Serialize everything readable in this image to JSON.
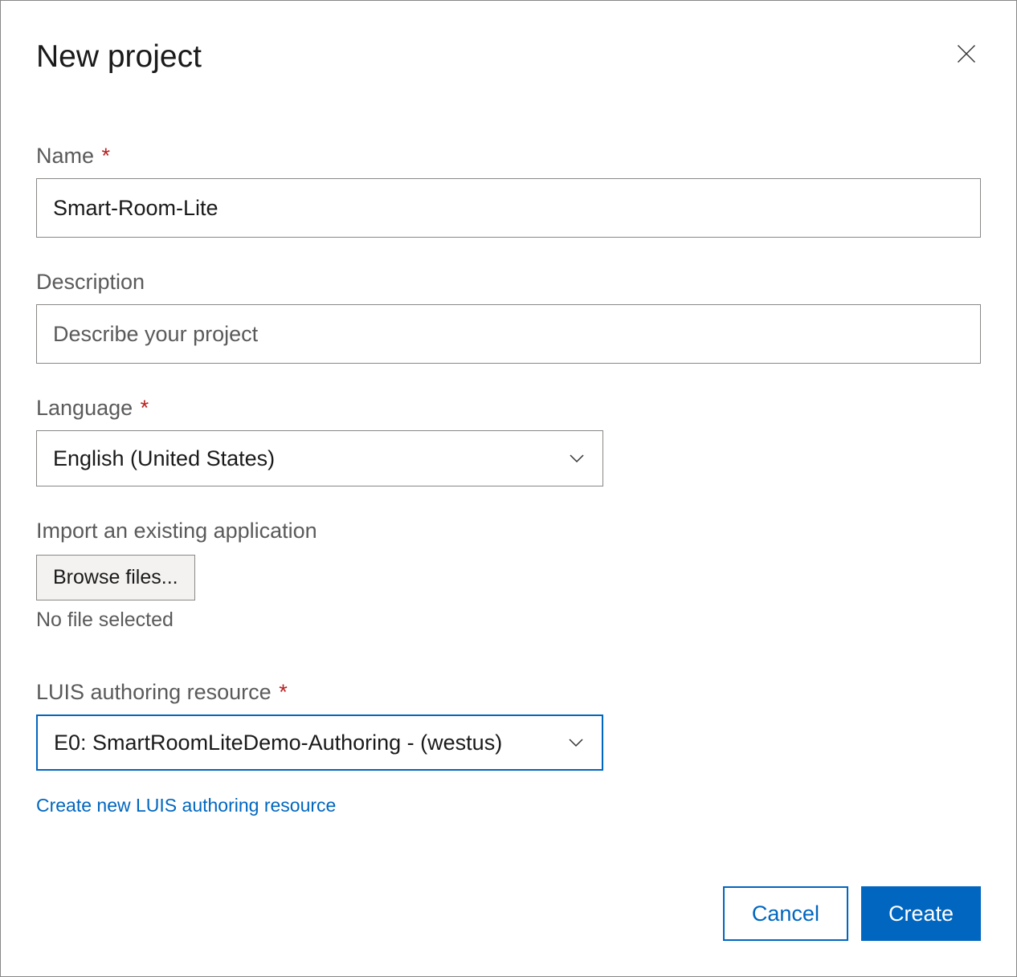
{
  "dialog": {
    "title": "New project"
  },
  "fields": {
    "name": {
      "label": "Name",
      "value": "Smart-Room-Lite",
      "required": true
    },
    "description": {
      "label": "Description",
      "placeholder": "Describe your project",
      "value": ""
    },
    "language": {
      "label": "Language",
      "value": "English (United States)",
      "required": true
    },
    "import": {
      "label": "Import an existing application",
      "button": "Browse files...",
      "status": "No file selected"
    },
    "luis": {
      "label": "LUIS authoring resource",
      "value": "E0: SmartRoomLiteDemo-Authoring - (westus)",
      "required": true,
      "create_link": "Create new LUIS authoring resource"
    }
  },
  "footer": {
    "cancel": "Cancel",
    "create": "Create"
  }
}
